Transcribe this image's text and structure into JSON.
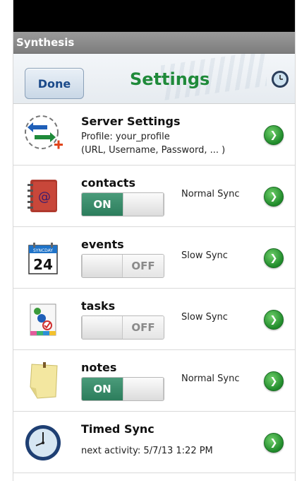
{
  "app": {
    "title": "Synthesis"
  },
  "header": {
    "done_label": "Done",
    "title": "Settings"
  },
  "rows": [
    {
      "name": "Server Settings",
      "line1": "Profile: your_profile",
      "line2": "(URL, Username, Password, ... )"
    },
    {
      "name": "contacts",
      "toggle": "ON",
      "mode": "Normal Sync"
    },
    {
      "name": "events",
      "toggle": "OFF",
      "mode": "Slow Sync",
      "calendar_month": "SYNCDAY",
      "calendar_day": "24"
    },
    {
      "name": "tasks",
      "toggle": "OFF",
      "mode": "Slow Sync"
    },
    {
      "name": "notes",
      "toggle": "ON",
      "mode": "Normal Sync"
    },
    {
      "name": "Timed Sync",
      "line1": "next activity:  5/7/13  1:22 PM"
    }
  ],
  "colors": {
    "accent_green": "#1f8a3a",
    "toggle_on": "#2c7d5c",
    "done_text": "#1b4a8a"
  }
}
